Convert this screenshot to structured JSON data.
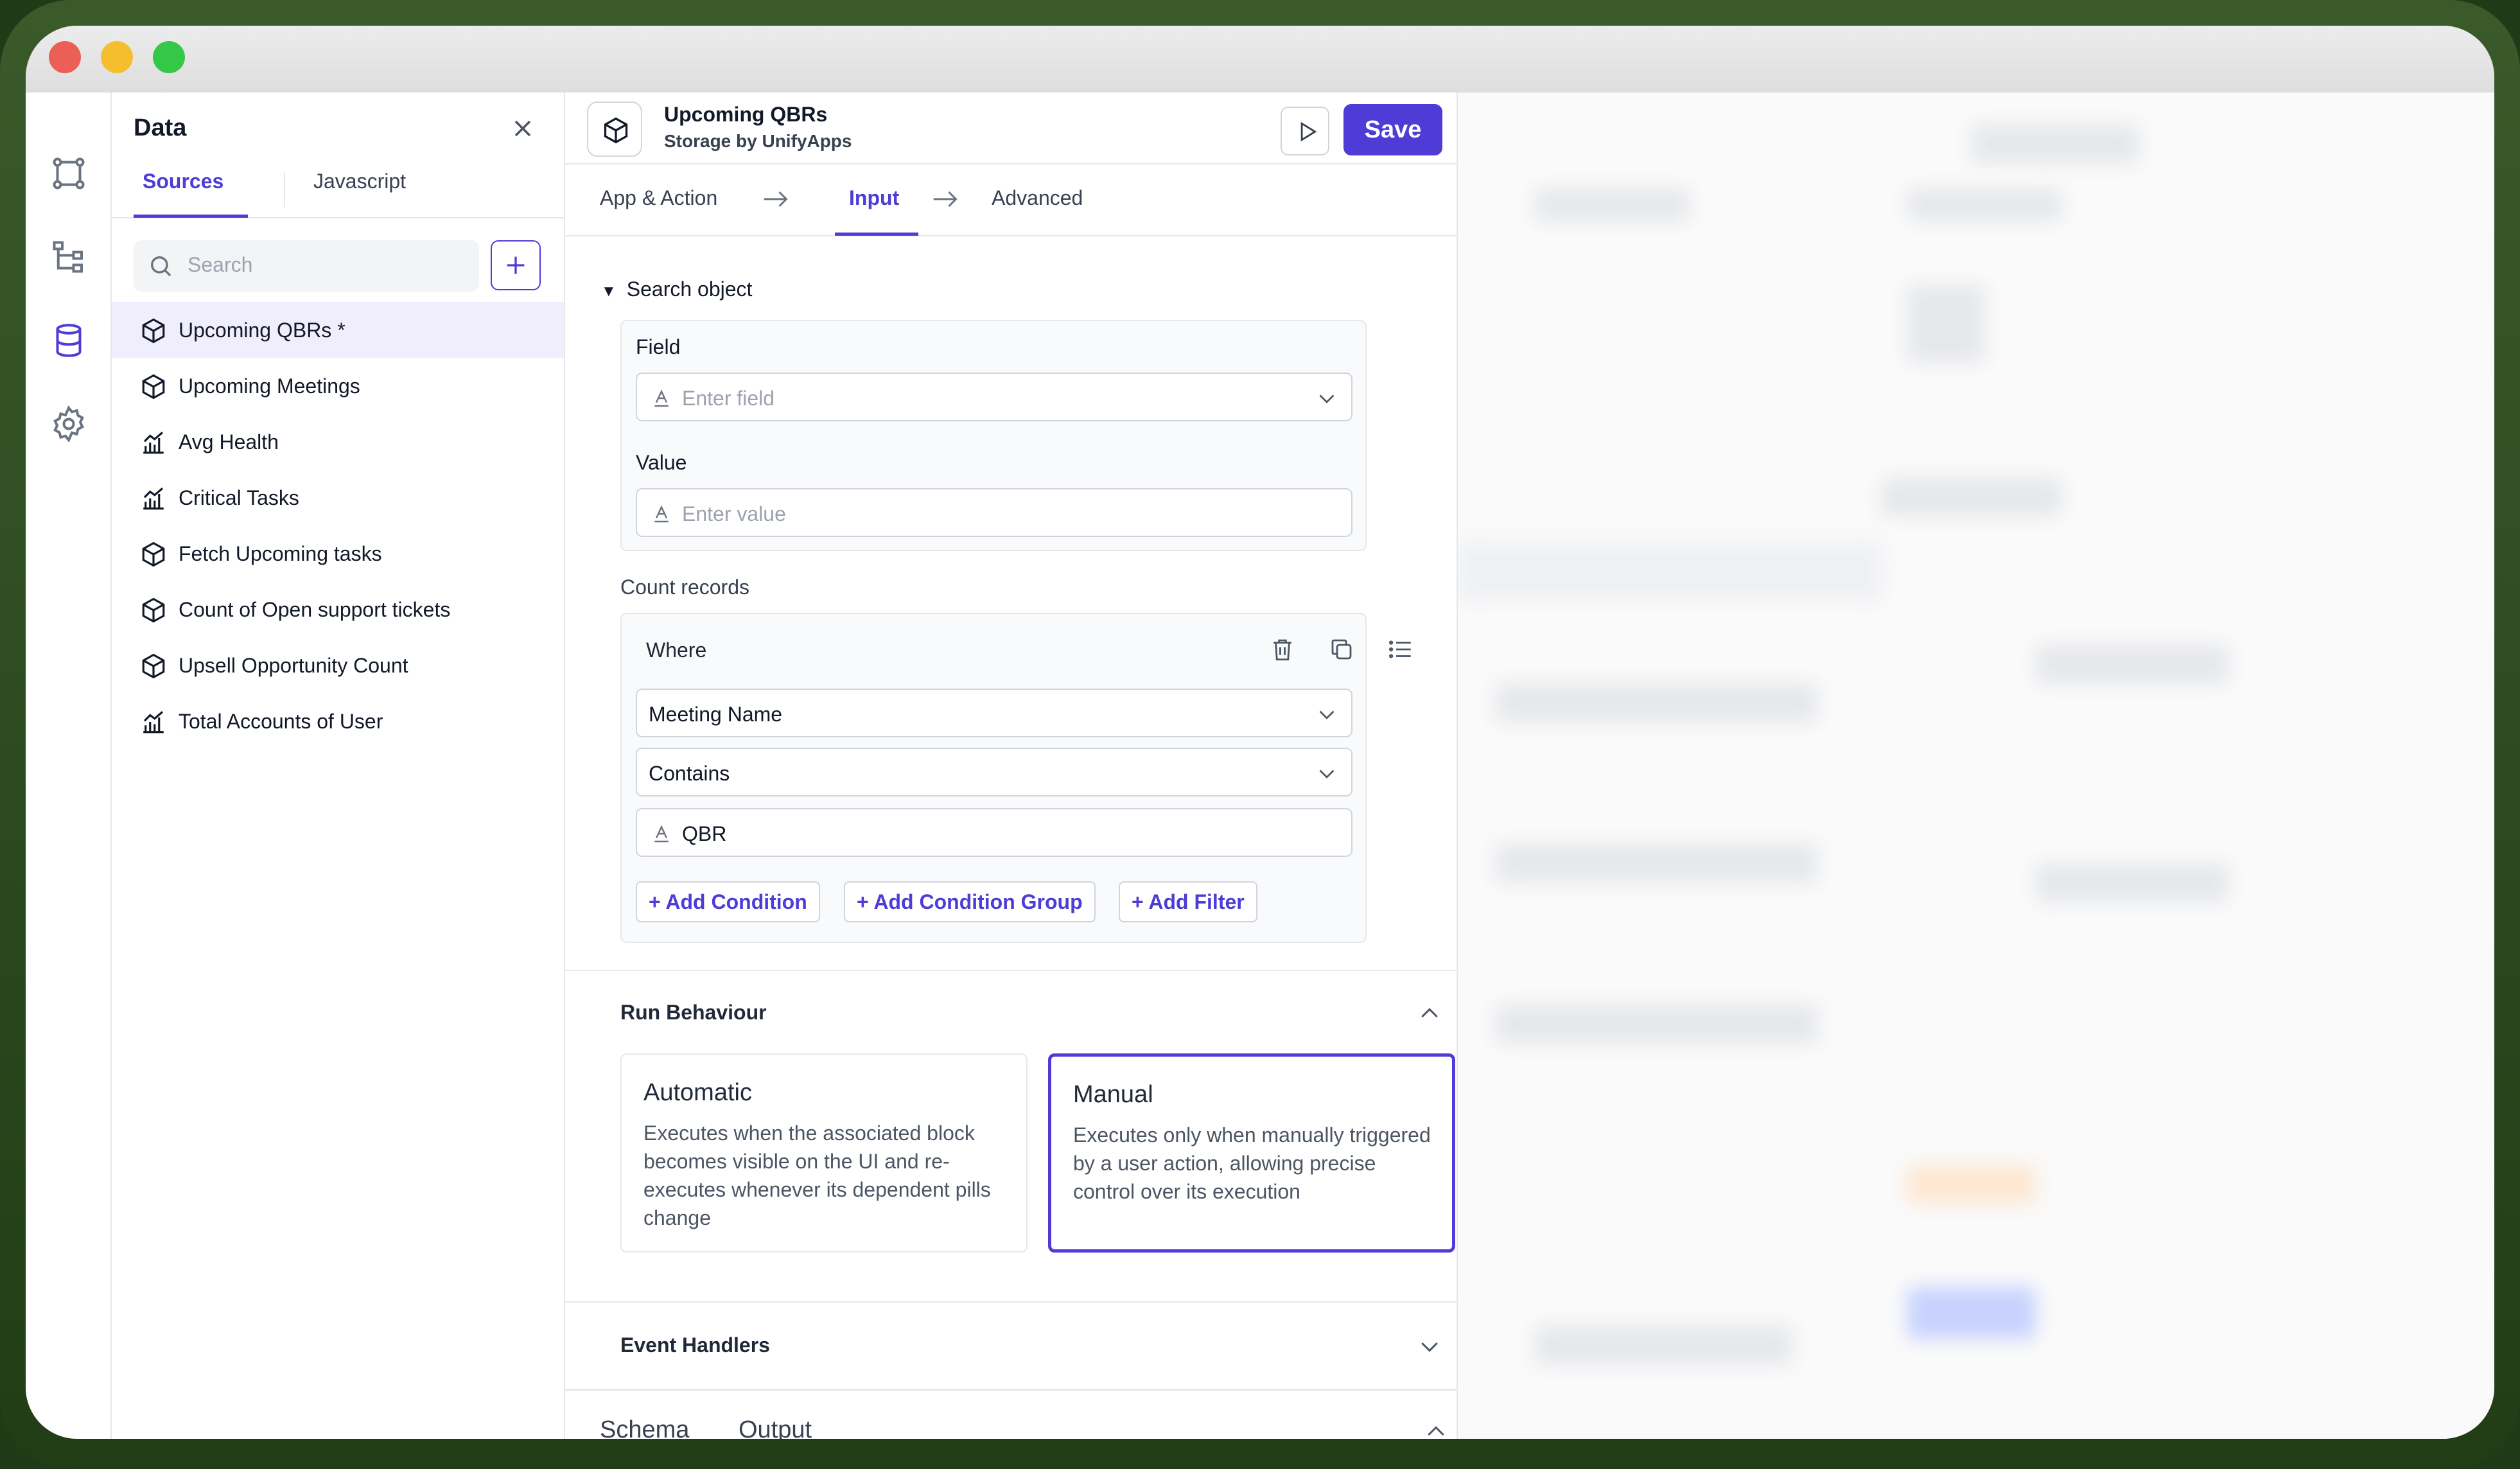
{
  "window": {
    "controls": [
      "close",
      "minimize",
      "maximize"
    ]
  },
  "rail": {
    "icons": [
      "frame-icon",
      "tree-icon",
      "database-icon",
      "gear-icon"
    ]
  },
  "data_panel": {
    "title": "Data",
    "tabs": [
      {
        "label": "Sources"
      },
      {
        "label": "Javascript"
      }
    ],
    "search": {
      "placeholder": "Search"
    },
    "items": [
      {
        "label": "Upcoming QBRs *",
        "icon": "cube-icon"
      },
      {
        "label": "Upcoming Meetings",
        "icon": "cube-icon"
      },
      {
        "label": "Avg Health",
        "icon": "chart-icon"
      },
      {
        "label": "Critical Tasks",
        "icon": "chart-icon"
      },
      {
        "label": "Fetch Upcoming tasks",
        "icon": "cube-icon"
      },
      {
        "label": "Count of Open support tickets",
        "icon": "cube-icon"
      },
      {
        "label": "Upsell Opportunity Count",
        "icon": "cube-icon"
      },
      {
        "label": "Total Accounts of User",
        "icon": "chart-icon"
      }
    ]
  },
  "editor": {
    "title": "Upcoming QBRs",
    "subtitle": "Storage by UnifyApps",
    "save_label": "Save",
    "steps": [
      {
        "label": "App & Action"
      },
      {
        "label": "Input"
      },
      {
        "label": "Advanced"
      }
    ],
    "search_object": {
      "label": "Search object",
      "field_label": "Field",
      "field_placeholder": "Enter field",
      "value_label": "Value",
      "value_placeholder": "Enter value"
    },
    "count_records": {
      "label": "Count records",
      "where_label": "Where",
      "field_value": "Meeting Name",
      "operator_value": "Contains",
      "match_value": "QBR",
      "buttons": {
        "add_condition": "+ Add Condition",
        "add_condition_group": "+ Add Condition Group",
        "add_filter": "+ Add Filter"
      }
    },
    "run_behaviour": {
      "label": "Run Behaviour",
      "automatic": {
        "title": "Automatic",
        "desc": "Executes when the associated block becomes visible on the UI and re-executes whenever its dependent pills change"
      },
      "manual": {
        "title": "Manual",
        "desc": "Executes only when manually triggered by a user action, allowing precise control over its execution"
      }
    },
    "event_handlers": {
      "label": "Event Handlers"
    },
    "bottom_tabs": [
      {
        "label": "Schema"
      },
      {
        "label": "Output"
      }
    ]
  },
  "colors": {
    "accent": "#4f3bd6",
    "selected_bg": "#f0eefd"
  }
}
